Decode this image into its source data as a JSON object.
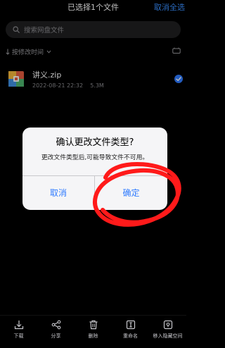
{
  "header": {
    "title": "已选择1个文件",
    "cancel_all": "取消全选"
  },
  "search": {
    "placeholder": "搜索网盘文件"
  },
  "sort": {
    "label": "按修改时间"
  },
  "files": [
    {
      "name": "讲义.zip",
      "date": "2022-08-21 22:32",
      "size": "5.3M",
      "selected": true
    }
  ],
  "dialog": {
    "title": "确认更改文件类型?",
    "message": "更改文件类型后,可能导致文件不可用。",
    "cancel_label": "取消",
    "confirm_label": "确定"
  },
  "bottom_bar": {
    "items": [
      {
        "label": "下载",
        "icon": "download-icon"
      },
      {
        "label": "分享",
        "icon": "share-icon"
      },
      {
        "label": "删除",
        "icon": "trash-icon"
      },
      {
        "label": "重命名",
        "icon": "rename-icon"
      },
      {
        "label": "移入隐藏空间",
        "icon": "hidden-space-icon"
      }
    ]
  },
  "colors": {
    "accent": "#2f7bff",
    "background": "#000000",
    "annotation_red": "#ff1a1a"
  }
}
